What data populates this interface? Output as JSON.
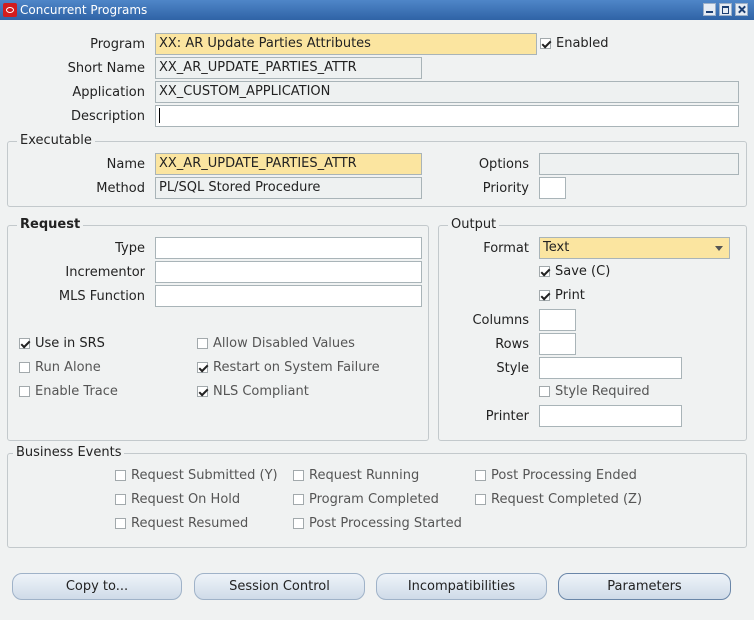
{
  "window": {
    "title": "Concurrent Programs",
    "icon": "oracle-icon",
    "controls": [
      "minimize-icon",
      "maximize-icon",
      "close-icon"
    ]
  },
  "header": {
    "program_label": "Program",
    "program_value": "XX: AR Update Parties Attributes",
    "enabled_label": "Enabled",
    "enabled_checked": true,
    "short_name_label": "Short Name",
    "short_name_value": "XX_AR_UPDATE_PARTIES_ATTR",
    "application_label": "Application",
    "application_value": "XX_CUSTOM_APPLICATION",
    "description_label": "Description",
    "description_value": ""
  },
  "executable": {
    "title": "Executable",
    "name_label": "Name",
    "name_value": "XX_AR_UPDATE_PARTIES_ATTR",
    "method_label": "Method",
    "method_value": "PL/SQL Stored Procedure",
    "options_label": "Options",
    "options_value": "",
    "priority_label": "Priority",
    "priority_value": ""
  },
  "request": {
    "title": "Request",
    "type_label": "Type",
    "type_value": "",
    "incrementor_label": "Incrementor",
    "incrementor_value": "",
    "mls_label": "MLS Function",
    "mls_value": "",
    "checkboxes": [
      {
        "label": "Use in SRS",
        "checked": true
      },
      {
        "label": "Run Alone",
        "checked": false
      },
      {
        "label": "Enable Trace",
        "checked": false
      },
      {
        "label": "Allow Disabled Values",
        "checked": false
      },
      {
        "label": "Restart on System Failure",
        "checked": true
      },
      {
        "label": "NLS Compliant",
        "checked": true
      }
    ]
  },
  "output": {
    "title": "Output",
    "format_label": "Format",
    "format_value": "Text",
    "save_label": "Save (C)",
    "save_checked": true,
    "print_label": "Print",
    "print_checked": true,
    "columns_label": "Columns",
    "columns_value": "",
    "rows_label": "Rows",
    "rows_value": "",
    "style_label": "Style",
    "style_value": "",
    "style_required_label": "Style Required",
    "style_required_checked": false,
    "printer_label": "Printer",
    "printer_value": ""
  },
  "business_events": {
    "title": "Business Events",
    "items": [
      {
        "label": "Request Submitted (Y)",
        "checked": false
      },
      {
        "label": "Request On Hold",
        "checked": false
      },
      {
        "label": "Request Resumed",
        "checked": false
      },
      {
        "label": "Request Running",
        "checked": false
      },
      {
        "label": "Program Completed",
        "checked": false
      },
      {
        "label": "Post Processing Started",
        "checked": false
      },
      {
        "label": "Post Processing Ended",
        "checked": false
      },
      {
        "label": "Request Completed (Z)",
        "checked": false
      }
    ]
  },
  "buttons": {
    "copy_to": "Copy to...",
    "session_control": "Session Control",
    "incompatibilities": "Incompatibilities",
    "parameters": "Parameters"
  },
  "colors": {
    "required_field": "#fbe5a0",
    "titlebar": "#3b6fb2",
    "background": "#f0f2f2"
  }
}
